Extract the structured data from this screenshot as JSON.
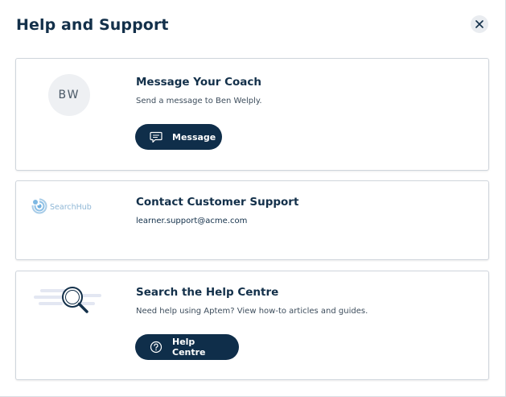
{
  "modal": {
    "title": "Help and Support",
    "close_icon": "close-icon"
  },
  "coach_card": {
    "avatar_initials": "BW",
    "title": "Message Your Coach",
    "description": "Send a message to Ben Welply.",
    "button_label": "Message",
    "button_icon": "chat-bubble-icon"
  },
  "support_card": {
    "logo_text": "SearchHub",
    "logo_icon": "searchhub-logo-icon",
    "title": "Contact Customer Support",
    "email": "learner.support@acme.com"
  },
  "help_card": {
    "illustration_icon": "magnifying-glass-illustration-icon",
    "title": "Search the Help Centre",
    "description": "Need help using Aptem? View how-to articles and guides.",
    "button_label": "Help Centre",
    "button_icon": "question-circle-icon"
  },
  "colors": {
    "primary": "#0f2e4a",
    "text": "#13304a",
    "card_border": "#cfd5dc",
    "logo_blue": "#8fb7d6"
  }
}
